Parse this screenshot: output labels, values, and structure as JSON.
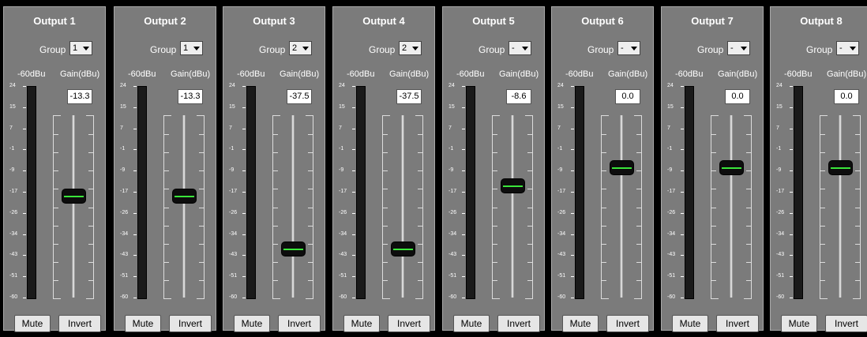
{
  "labels": {
    "group": "Group",
    "meter": "-60dBu",
    "gain": "Gain(dBu)",
    "mute": "Mute",
    "invert": "Invert"
  },
  "scale_ticks": [
    "24",
    "15",
    "7",
    "-1",
    "-9",
    "-17",
    "-26",
    "-34",
    "-43",
    "-51",
    "-60"
  ],
  "gain_range_dbu": [
    -60,
    24
  ],
  "colors": {
    "fader_indicator": "#3be63b",
    "strip_background": "#7b7b7b",
    "meter_background": "#1a1a1a"
  },
  "outputs": [
    {
      "title": "Output 1",
      "group": "1",
      "gain": "-13.3"
    },
    {
      "title": "Output 2",
      "group": "1",
      "gain": "-13.3"
    },
    {
      "title": "Output 3",
      "group": "2",
      "gain": "-37.5"
    },
    {
      "title": "Output 4",
      "group": "2",
      "gain": "-37.5"
    },
    {
      "title": "Output 5",
      "group": "-",
      "gain": "-8.6"
    },
    {
      "title": "Output 6",
      "group": "-",
      "gain": "0.0"
    },
    {
      "title": "Output 7",
      "group": "-",
      "gain": "0.0"
    },
    {
      "title": "Output 8",
      "group": "-",
      "gain": "0.0"
    }
  ]
}
